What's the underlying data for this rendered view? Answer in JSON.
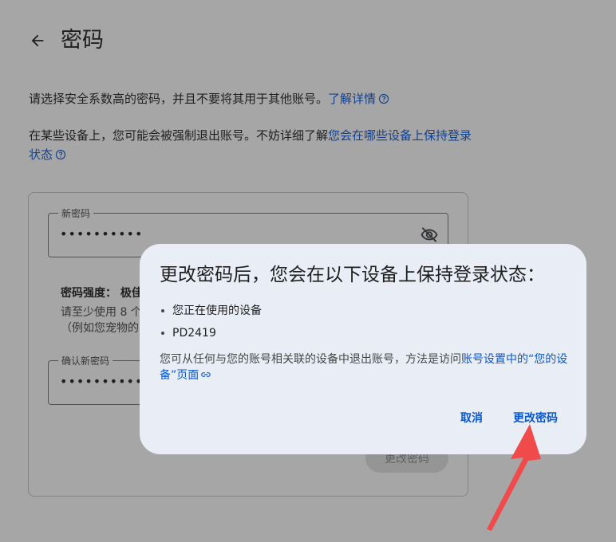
{
  "header": {
    "title": "密码"
  },
  "intro": {
    "line1_text": "请选择安全系数高的密码，并且不要将其用于其他账号。",
    "line1_link": "了解详情",
    "line2_text": "在某些设备上，您可能会被强制退出账号。不妨详细了解",
    "line2_link": "您会在哪些设备上保持登录状态"
  },
  "form": {
    "new_password": {
      "label": "新密码",
      "value": "••••••••••"
    },
    "strength_text": "密码强度：  极佳",
    "hint_text": "请至少使用 8 个\n（例如您宠物的",
    "confirm_password": {
      "label": "确认新密码",
      "value": "••••••••••"
    },
    "submit_label": "更改密码"
  },
  "dialog": {
    "title": "更改密码后，您会在以下设备上保持登录状态：",
    "devices": [
      "您正在使用的设备",
      "PD2419"
    ],
    "note_text": "您可从任何与您的账号相关联的设备中退出账号，方法是访问",
    "note_link": "账号设置中的“您的设备”页面",
    "cancel_label": "取消",
    "confirm_label": "更改密码"
  },
  "colors": {
    "link": "#0b57d0",
    "dialog_bg": "#e9eef6",
    "annotation_arrow": "#f04a4a"
  }
}
